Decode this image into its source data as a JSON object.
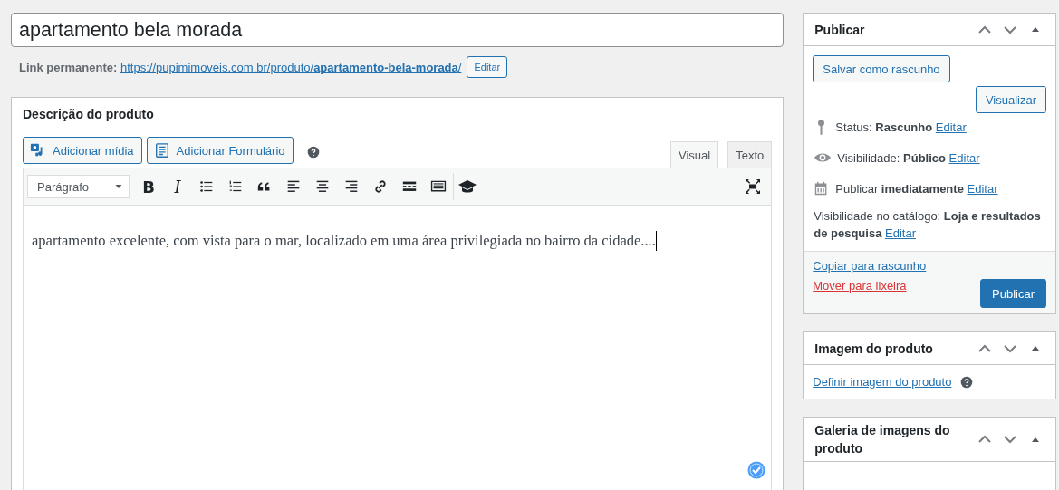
{
  "title_field": {
    "value": "apartamento bela morada"
  },
  "permalink": {
    "label": "Link permanente:",
    "url": "https://pupimimoveis.com.br/produto/**apartamento-bela-morada**/",
    "button": "Editar"
  },
  "description_box": {
    "title": "Descrição do produto",
    "media_buttons": [
      {
        "kind": "media",
        "label": "Adicionar mídia"
      },
      {
        "kind": "form",
        "label": "Adicionar Formulário"
      }
    ],
    "tabs": [
      {
        "label": "Visual",
        "selected": true
      },
      {
        "label": "Texto",
        "selected": false
      }
    ],
    "format_select": "Parágrafo",
    "toolbar": [
      {
        "kind": "bold",
        "glyph": "B"
      },
      {
        "kind": "italic",
        "glyph": "I"
      },
      {
        "kind": "bullets"
      },
      {
        "kind": "numbers"
      },
      {
        "kind": "quote"
      },
      {
        "kind": "align-left"
      },
      {
        "kind": "align-center"
      },
      {
        "kind": "align-right"
      },
      {
        "kind": "link"
      },
      {
        "kind": "more"
      },
      {
        "kind": "keyboard"
      },
      {
        "kind": "cap"
      }
    ],
    "content": "apartamento excelente, com vista para o mar, localizado em uma área privilegiada no bairro da cidade...."
  },
  "publish_box": {
    "title": "Publicar",
    "save_button": "Salvar como rascunho",
    "preview_button": "Visualizar",
    "meta": [
      {
        "kind": "status",
        "text": "Status: **Rascunho**",
        "link": "Editar"
      },
      {
        "kind": "visibility",
        "text": "Visibilidade: **Público**",
        "link": "Editar"
      },
      {
        "kind": "schedule",
        "text": "Publicar **imediatamente**",
        "link": "Editar"
      },
      {
        "kind": "plain",
        "text": "Visibilidade no catálogo: **Loja e resultados de pesquisa**",
        "link": "Editar"
      }
    ],
    "copy_link": "Copiar para rascunho",
    "trash_link": "Mover para lixeira",
    "publish_button": "Publicar"
  },
  "image_box": {
    "title": "Imagem do produto",
    "link": "Definir imagem do produto"
  },
  "gallery_box": {
    "title": "Galeria de imagens do produto"
  }
}
